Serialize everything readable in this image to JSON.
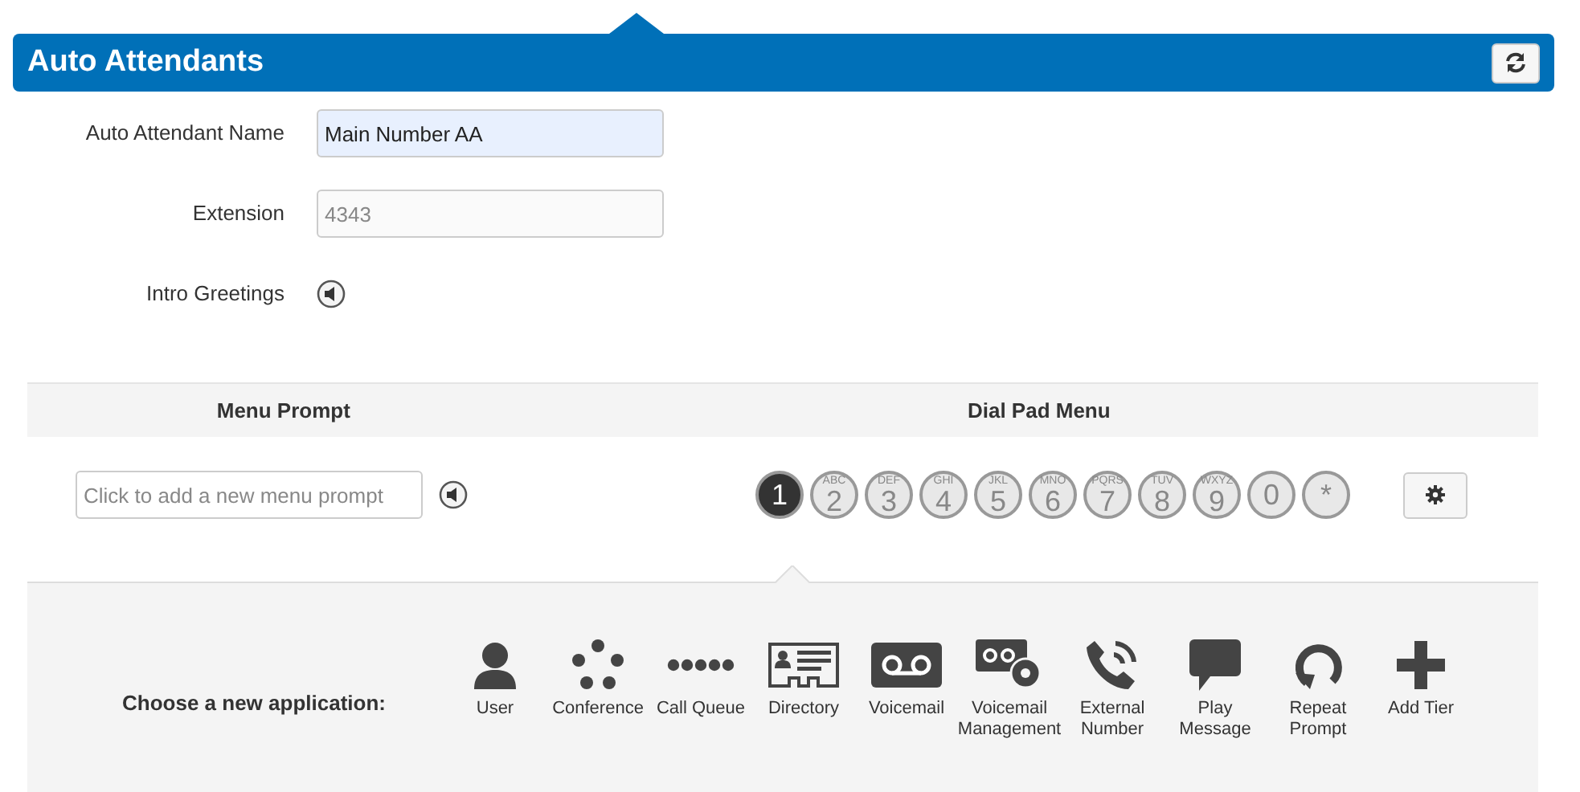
{
  "header": {
    "title": "Auto Attendants"
  },
  "form": [
    {
      "label": "Auto Attendant Name",
      "kind": "input",
      "value": "Main Number AA",
      "disabled": false
    },
    {
      "label": "Extension",
      "kind": "input",
      "value": "4343",
      "disabled": true
    },
    {
      "label": "Intro Greetings",
      "kind": "audio"
    }
  ],
  "menu": {
    "prompt_heading": "Menu Prompt",
    "dialpad_heading": "Dial Pad Menu",
    "prompt_placeholder": "Click to add a new menu prompt",
    "keys": [
      {
        "digit": "1",
        "selected": true
      },
      {
        "digit": "2",
        "letters": "ABC",
        "selected": false
      },
      {
        "digit": "3",
        "letters": "DEF",
        "selected": false
      },
      {
        "digit": "4",
        "letters": "GHI",
        "selected": false
      },
      {
        "digit": "5",
        "letters": "JKL",
        "selected": false
      },
      {
        "digit": "6",
        "letters": "MNO",
        "selected": false
      },
      {
        "digit": "7",
        "letters": "PQRS",
        "selected": false
      },
      {
        "digit": "8",
        "letters": "TUV",
        "selected": false
      },
      {
        "digit": "9",
        "letters": "WXYZ",
        "selected": false
      },
      {
        "digit": "0",
        "selected": false
      },
      {
        "digit": "*",
        "selected": false
      }
    ]
  },
  "applications": {
    "label": "Choose a new application:",
    "items": [
      {
        "kind": "user",
        "label": "User"
      },
      {
        "kind": "conference",
        "label": "Conference"
      },
      {
        "kind": "queue",
        "label": "Call Queue"
      },
      {
        "kind": "directory",
        "label": "Directory"
      },
      {
        "kind": "voicemail",
        "label": "Voicemail"
      },
      {
        "kind": "vm_manage",
        "label": "Voicemail Management"
      },
      {
        "kind": "external",
        "label": "External Number"
      },
      {
        "kind": "play",
        "label": "Play Message"
      },
      {
        "kind": "repeat",
        "label": "Repeat Prompt"
      },
      {
        "kind": "add",
        "label": "Add Tier"
      }
    ]
  }
}
